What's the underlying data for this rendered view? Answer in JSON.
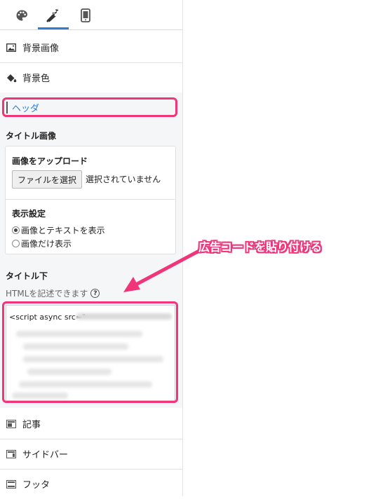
{
  "tabs": [
    {
      "icon": "palette-icon"
    },
    {
      "icon": "wrench-icon"
    },
    {
      "icon": "mobile-icon"
    }
  ],
  "menu": {
    "background_image": "背景画像",
    "background_color": "背景色",
    "header": "ヘッダ",
    "article": "記事",
    "sidebar": "サイドバー",
    "footer": "フッタ"
  },
  "title_image": {
    "heading": "タイトル画像",
    "upload_label": "画像をアップロード",
    "file_button": "ファイルを選択",
    "file_status": "選択されていません",
    "display_label": "表示設定",
    "options": [
      "画像とテキストを表示",
      "画像だけ表示"
    ],
    "selected_option": 0
  },
  "below_title": {
    "heading": "タイトル下",
    "hint": "HTMLを記述できます",
    "code_start": "<script async src=\""
  },
  "annotation": {
    "text": "広告コードを貼り付ける",
    "color": "#f0357a"
  },
  "colors": {
    "accent": "#2d7dd2",
    "highlight": "#f0357a"
  }
}
